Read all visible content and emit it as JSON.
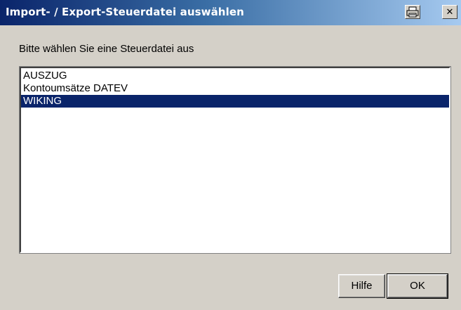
{
  "window": {
    "title": "Import- / Export-Steuerdatei auswählen"
  },
  "titlebar_buttons": {
    "print_icon": "printer-icon",
    "close_glyph": "✕"
  },
  "prompt": "Bitte wählen Sie eine Steuerdatei aus",
  "list": {
    "items": [
      {
        "label": "AUSZUG",
        "selected": false
      },
      {
        "label": "Kontoumsätze DATEV",
        "selected": false
      },
      {
        "label": "WIKING",
        "selected": true
      }
    ]
  },
  "buttons": {
    "help_label": "Hilfe",
    "ok_label": "OK"
  },
  "colors": {
    "title_gradient_start": "#0a246a",
    "title_gradient_end": "#a6caf0",
    "selection": "#0a246a",
    "face": "#d4d0c8"
  }
}
